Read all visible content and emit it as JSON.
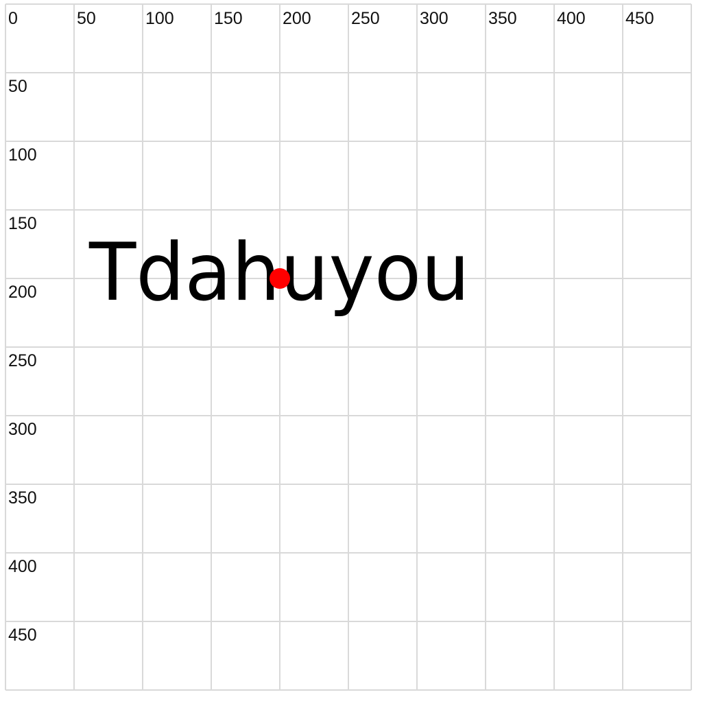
{
  "grid": {
    "x_ticks": [
      "0",
      "50",
      "100",
      "150",
      "200",
      "250",
      "300",
      "350",
      "400",
      "450"
    ],
    "y_ticks": [
      "50",
      "100",
      "150",
      "200",
      "250",
      "300",
      "350",
      "400",
      "450"
    ],
    "line_color": "#d9d9d9"
  },
  "word": {
    "text": "Tdahuyou",
    "color": "#000000"
  },
  "marker": {
    "x": 200,
    "y": 200,
    "color": "#ff0000"
  }
}
